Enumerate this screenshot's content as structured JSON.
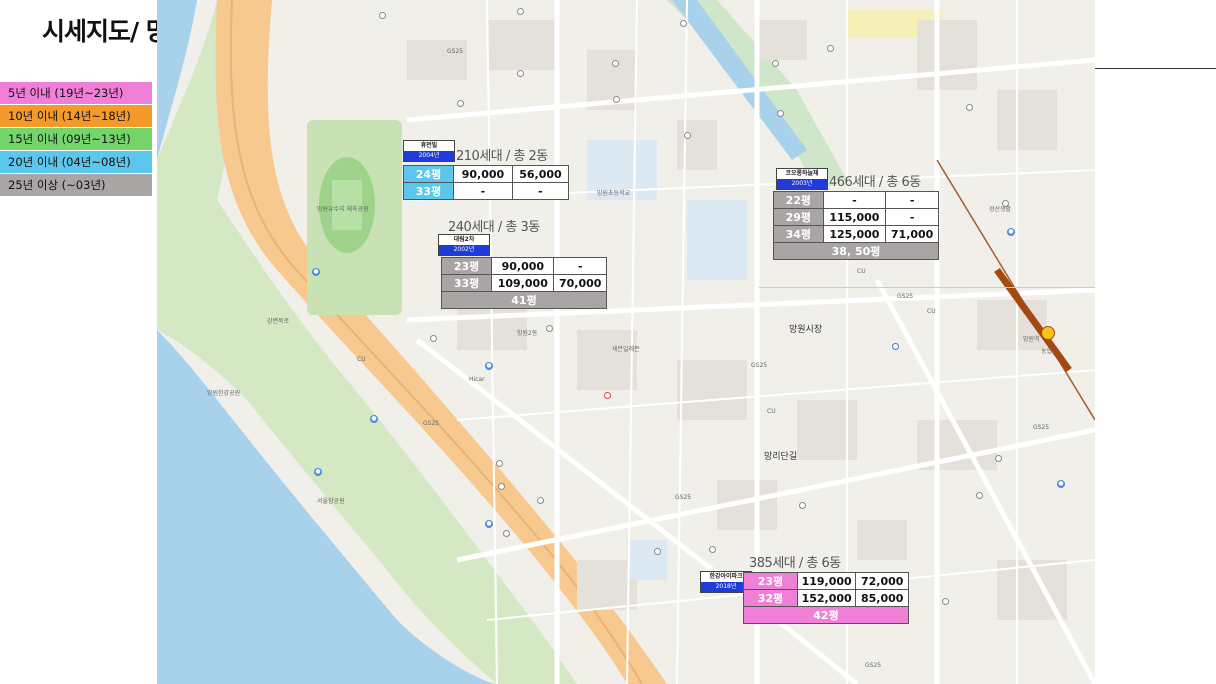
{
  "title": "시세지도/ 망원생활권",
  "legend": [
    {
      "label": "5년 이내 (19년~23년)",
      "color": "#f07fd8"
    },
    {
      "label": "10년 이내 (14년~18년)",
      "color": "#f39a2a"
    },
    {
      "label": "15년 이내 (09년~13년)",
      "color": "#74d56a"
    },
    {
      "label": "20년 이내 (04년~08년)",
      "color": "#5cc6ec"
    },
    {
      "label": "25년 이상 (~03년)",
      "color": "#a9a5a5"
    }
  ],
  "map_labels": {
    "mangwon_market": "망원시장",
    "mangridan": "망리단길",
    "mangwon_station": "망원역",
    "cu": "CU",
    "gs25": "GS25",
    "sports_park": "망원유수지 체육공원",
    "hangang_park": "망원한강공원",
    "seoul_pulse": "서울함공원",
    "kyochon": "망원초등학교",
    "haejangguk": "세븐일레븐",
    "hicar": "Hicar",
    "nonghyup": "농협",
    "mangwon2": "망원2동",
    "seongsan": "성산생활",
    "gangbyeon": "강변북로"
  },
  "complexes": [
    {
      "name": "휴먼빌",
      "year": "2004년",
      "households": "210세대 / 총 2동",
      "color": "#5cc6ec",
      "rows": [
        {
          "pyeong": "24평",
          "v1": "90,000",
          "v2": "56,000"
        },
        {
          "pyeong": "33평",
          "v1": "-",
          "v2": "-"
        }
      ],
      "summary": ""
    },
    {
      "name": "대림2차",
      "year": "2002년",
      "households": "240세대 / 총 3동",
      "color": "#a9a5a5",
      "rows": [
        {
          "pyeong": "23평",
          "v1": "90,000",
          "v2": "-"
        },
        {
          "pyeong": "33평",
          "v1": "109,000",
          "v2": "70,000"
        }
      ],
      "summary": "41평"
    },
    {
      "name": "코오롱하늘채",
      "year": "2003년",
      "households": "466세대 / 총 6동",
      "color": "#a9a5a5",
      "rows": [
        {
          "pyeong": "22평",
          "v1": "-",
          "v2": "-"
        },
        {
          "pyeong": "29평",
          "v1": "115,000",
          "v2": "-"
        },
        {
          "pyeong": "34평",
          "v1": "125,000",
          "v2": "71,000"
        }
      ],
      "summary": "38, 50평"
    },
    {
      "name": "한강아이파크",
      "year": "2018년",
      "households": "385세대 / 총 6동",
      "color": "#f07fd8",
      "rows": [
        {
          "pyeong": "23평",
          "v1": "119,000",
          "v2": "72,000"
        },
        {
          "pyeong": "32평",
          "v1": "152,000",
          "v2": "85,000"
        }
      ],
      "summary": "42평"
    }
  ]
}
